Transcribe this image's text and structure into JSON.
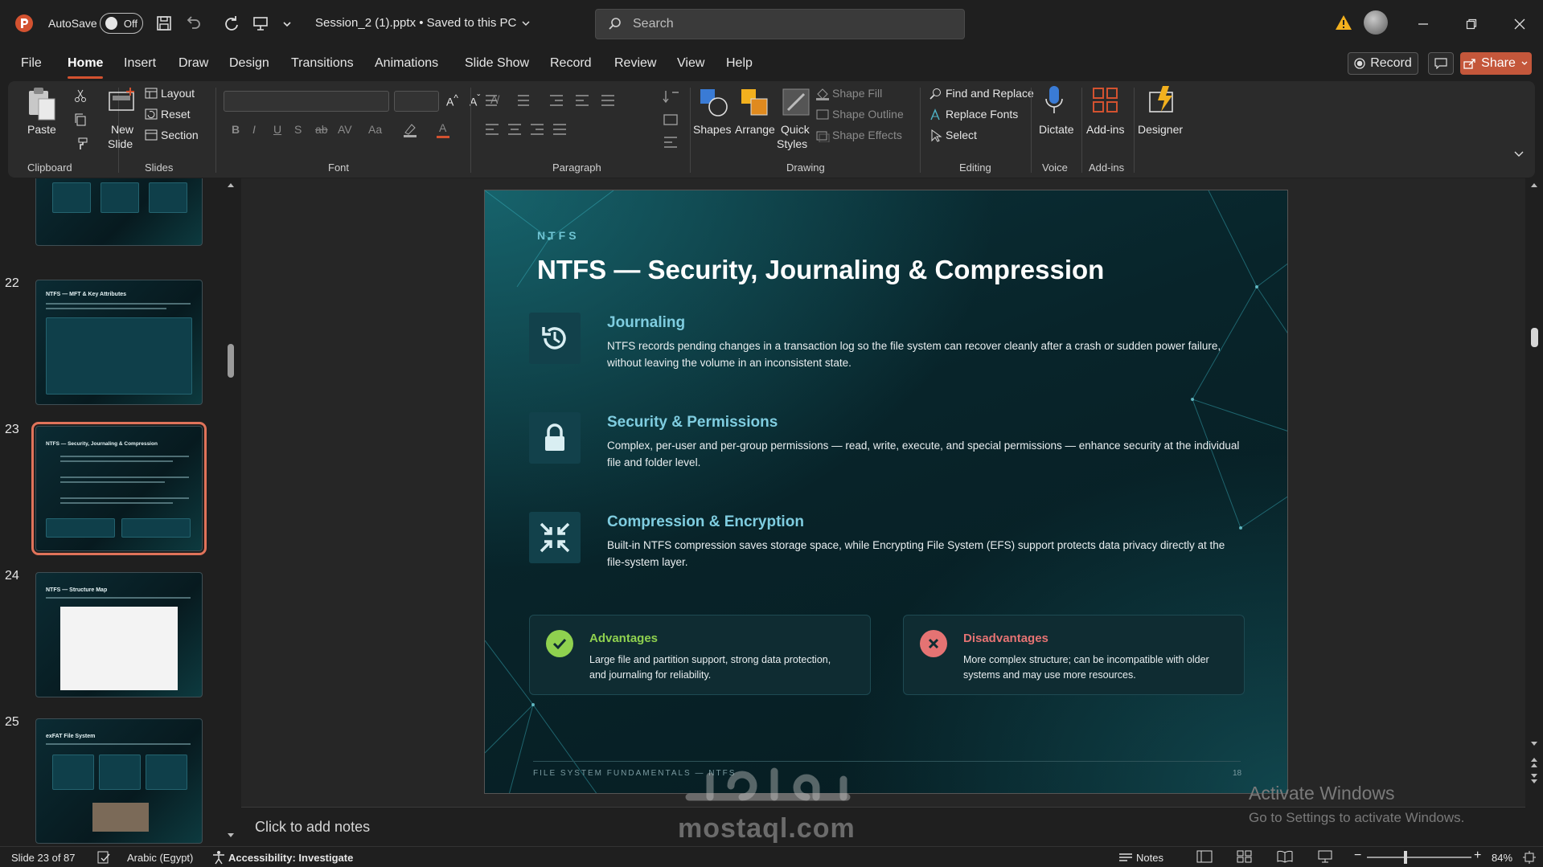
{
  "titlebar": {
    "autosave_label": "AutoSave",
    "autosave_state": "Off",
    "document_title": "Session_2 (1).pptx  •  Saved to this PC",
    "search_placeholder": "Search"
  },
  "tabs": [
    "File",
    "Home",
    "Insert",
    "Draw",
    "Design",
    "Transitions",
    "Animations",
    "Slide Show",
    "Record",
    "Review",
    "View",
    "Help"
  ],
  "active_tab": "Home",
  "actions": {
    "record": "Record",
    "share": "Share"
  },
  "ribbon": {
    "clipboard": {
      "paste": "Paste",
      "label": "Clipboard"
    },
    "slides": {
      "new_slide_1": "New",
      "new_slide_2": "Slide",
      "layout": "Layout",
      "reset": "Reset",
      "section": "Section",
      "label": "Slides"
    },
    "font": {
      "label": "Font"
    },
    "paragraph": {
      "label": "Paragraph"
    },
    "drawing": {
      "shapes": "Shapes",
      "arrange": "Arrange",
      "quick_1": "Quick",
      "quick_2": "Styles",
      "shape_fill": "Shape Fill",
      "shape_outline": "Shape Outline",
      "shape_effects": "Shape Effects",
      "label": "Drawing"
    },
    "editing": {
      "find_replace": "Find and Replace",
      "replace_fonts": "Replace Fonts",
      "select": "Select",
      "label": "Editing"
    },
    "voice": {
      "dictate": "Dictate",
      "label": "Voice"
    },
    "addins": {
      "addins": "Add-ins",
      "label": "Add-ins"
    },
    "designer": {
      "designer": "Designer"
    }
  },
  "thumbnails": [
    {
      "number": "22",
      "title": "NTFS — MFT & Key Attributes"
    },
    {
      "number": "23",
      "title": "NTFS — Security, Journaling & Compression",
      "selected": true
    },
    {
      "number": "24",
      "title": "NTFS — Structure Map"
    },
    {
      "number": "25",
      "title": "exFAT File System"
    }
  ],
  "slide": {
    "eyebrow": "NTFS",
    "title": "NTFS — Security, Journaling & Compression",
    "features": [
      {
        "icon": "history-icon",
        "heading": "Journaling",
        "body": "NTFS records pending changes in a transaction log so the file system can recover cleanly after a crash or sudden power failure, without leaving the volume in an inconsistent state."
      },
      {
        "icon": "lock-icon",
        "heading": "Security & Permissions",
        "body": "Complex, per-user and per-group permissions — read, write, execute, and special permissions — enhance security at the individual file and folder level."
      },
      {
        "icon": "compress-icon",
        "heading": "Compression & Encryption",
        "body": "Built-in NTFS compression saves storage space, while Encrypting File System (EFS) support protects data privacy directly at the file-system layer."
      }
    ],
    "advantages": {
      "title": "Advantages",
      "body": "Large file and partition support, strong data protection, and journaling for reliability."
    },
    "disadvantages": {
      "title": "Disadvantages",
      "body": "More complex structure; can be incompatible with older systems and may use more resources."
    },
    "footer": "FILE SYSTEM FUNDAMENTALS — NTFS",
    "page_number": "18"
  },
  "notes_placeholder": "Click to add notes",
  "statusbar": {
    "slide_count": "Slide 23 of 87",
    "language": "Arabic (Egypt)",
    "accessibility": "Accessibility: Investigate",
    "notes": "Notes",
    "zoom": "84%"
  },
  "watermark": {
    "activate_title": "Activate Windows",
    "activate_sub": "Go to Settings to activate Windows.",
    "brand": "mostaql.com"
  },
  "colors": {
    "accent": "#d35230",
    "slide_heading": "#7fcde0",
    "advantage": "#8fd14f",
    "disadvantage": "#e57373"
  }
}
